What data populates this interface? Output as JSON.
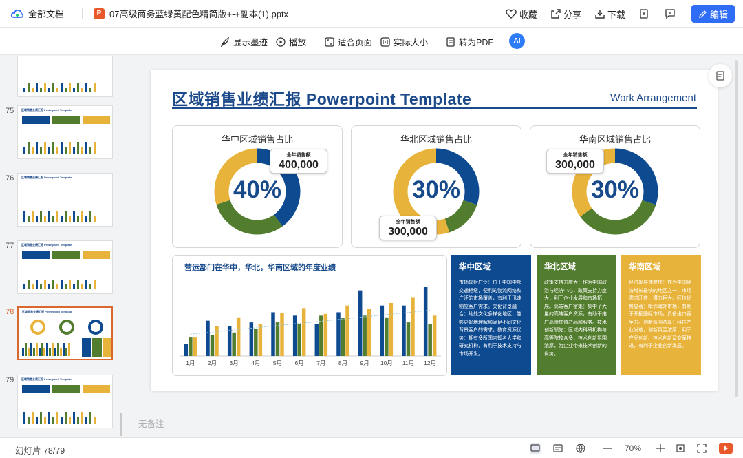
{
  "topbar": {
    "breadcrumb": "全部文档",
    "file_badge": "P",
    "filename": "07高级商务蓝绿黄配色精简版+-+副本(1).pptx",
    "actions": [
      "收藏",
      "分享",
      "下载"
    ],
    "edit_label": "编辑"
  },
  "toolbar": {
    "show_ink": "显示墨迹",
    "play": "播放",
    "fit_page": "适合页面",
    "actual_size": "实际大小",
    "to_pdf": "转为PDF",
    "ai_label": "AI"
  },
  "sidebar": {
    "thumbnails": [
      {
        "num": "",
        "title": ""
      },
      {
        "num": "75",
        "title": "区域销售业绩汇报 Powerpoint Template"
      },
      {
        "num": "76",
        "title": "区域销售业绩汇报 Powerpoint Template"
      },
      {
        "num": "77",
        "title": "区域销售业绩汇报 Powerpoint Template"
      },
      {
        "num": "78",
        "title": "区域销售业绩汇报 Powerpoint Template"
      },
      {
        "num": "79",
        "title": "区域销售业绩汇报 Powerpoint Template"
      }
    ]
  },
  "slide": {
    "title": "区域销售业绩汇报 Powerpoint Template",
    "subtitle": "Work Arrangement",
    "donuts": [
      {
        "title": "华中区域销售占比",
        "percent": "40%",
        "callout_label": "全年销售额",
        "callout_value": "400,000",
        "share": 0.4
      },
      {
        "title": "华北区域销售占比",
        "percent": "30%",
        "callout_label": "全年销售额",
        "callout_value": "300,000",
        "share": 0.3
      },
      {
        "title": "华南区域销售占比",
        "percent": "30%",
        "callout_label": "全年销售额",
        "callout_value": "300,000",
        "share": 0.3
      }
    ],
    "bar_title": "营运部门在华中，华北，华南区域的年度业绩",
    "regions": [
      {
        "name": "华中区域",
        "color": "#0d4a90",
        "text": "市场辐射广泛：位于中国中部交通枢纽，便利的物流网络和广泛的市场覆盖，有利于迅速响应客户需求。文化背景融合：地处文化多样化地区，能够更好地理解和满足不同文化背景客户的需求。教育资源优势：拥有多所国内知名大学和研究机构，有利于技术支持与市场开发。"
      },
      {
        "name": "华北区域",
        "color": "#527c2e",
        "text": "政策支持力度大：作为中国政治与经济中心，政策支持力度大，利于企业发展和市场拓展。高端客户密集：集中了大量的高端客户资源，有助于推广高附加值产品和服务。技术创新领先：区域内科研机构与高等院校众多，技术创新氛围浓厚，为企业带来技术创新的优势。"
      },
      {
        "name": "华南区域",
        "color": "#e8b33a",
        "text": "经济发展速度快：作为中国经济增长最快的地区之一，市场需求旺盛，潜力巨大。区位优势显著：毗邻海外市场，有利于开拓国际市场，具备出口竞争力。创新氛围浓厚：科技产业发达，创新氛围浓厚，利于产品创新、技术创新及变革推进，有利于企业创新发展。"
      }
    ],
    "notes": "无备注"
  },
  "chart_data": {
    "type": "bar",
    "title": "营运部门在华中，华北，华南区域的年度业绩",
    "categories": [
      "1月",
      "2月",
      "3月",
      "4月",
      "5月",
      "6月",
      "7月",
      "8月",
      "9月",
      "10月",
      "11月",
      "12月"
    ],
    "series": [
      {
        "color": "#0d4a90",
        "values": [
          14,
          42,
          36,
          40,
          52,
          48,
          38,
          52,
          78,
          60,
          60,
          82
        ]
      },
      {
        "color": "#527c2e",
        "values": [
          22,
          25,
          28,
          32,
          40,
          38,
          48,
          45,
          48,
          46,
          40,
          38
        ]
      },
      {
        "color": "#e8b33a",
        "values": [
          22,
          36,
          46,
          38,
          51,
          57,
          50,
          60,
          56,
          63,
          70,
          48
        ]
      }
    ],
    "trendline": true,
    "ylim": [
      0,
      90
    ]
  },
  "status": {
    "slide_count": "幻灯片 78/79",
    "zoom": "70%"
  }
}
